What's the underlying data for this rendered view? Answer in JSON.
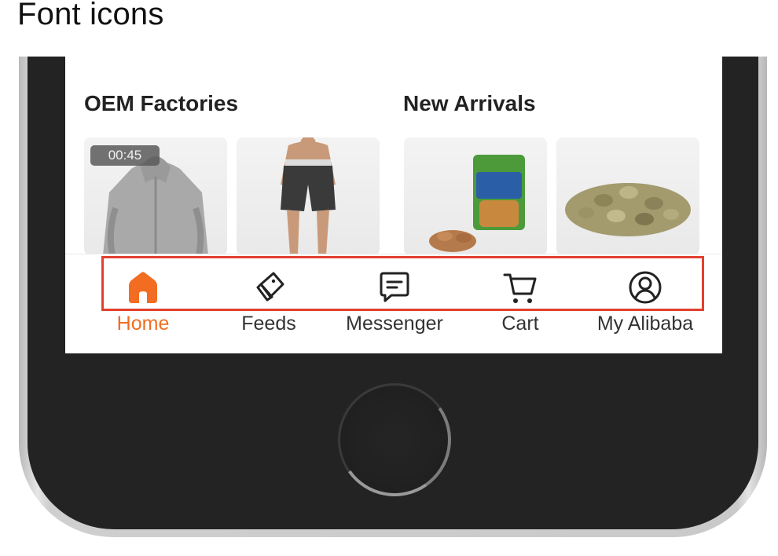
{
  "page": {
    "heading": "Font icons"
  },
  "sections": {
    "oem_title": "OEM Factories",
    "new_title": "New Arrivals",
    "video_badge": "00:45"
  },
  "tab_bar": {
    "items": [
      {
        "label": "Home",
        "icon": "home-icon",
        "active": true
      },
      {
        "label": "Feeds",
        "icon": "feeds-icon",
        "active": false
      },
      {
        "label": "Messenger",
        "icon": "messenger-icon",
        "active": false
      },
      {
        "label": "Cart",
        "icon": "cart-icon",
        "active": false
      },
      {
        "label": "My Alibaba",
        "icon": "profile-icon",
        "active": false
      }
    ]
  },
  "colors": {
    "accent": "#f26d21",
    "highlight": "#e2402f",
    "phone_body": "#232323"
  }
}
